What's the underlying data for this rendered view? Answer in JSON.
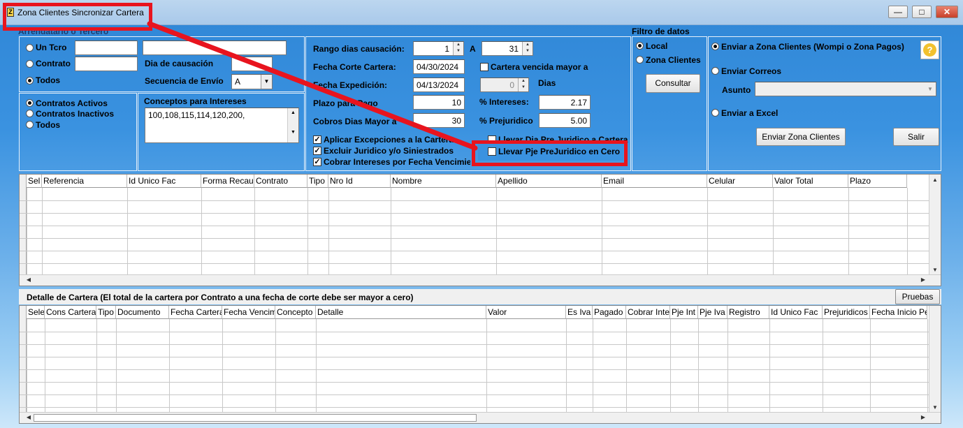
{
  "window": {
    "title": "Zona Clientes Sincronizar Cartera"
  },
  "left": {
    "group_label": "Arrendatario o Tercero",
    "un_tcro": "Un Tcro",
    "contrato": "Contrato",
    "todos": "Todos",
    "dia_causacion": "Dia de causación",
    "secuencia_envio": "Secuencia de Envío",
    "secuencia_value": "A",
    "contratos_activos": "Contratos Activos",
    "contratos_inactivos": "Contratos Inactivos",
    "todos2": "Todos",
    "conceptos_label": "Conceptos para Intereses",
    "conceptos_value": "100,108,115,114,120,200,"
  },
  "middle": {
    "rango_label": "Rango dias causación:",
    "rango_from": "1",
    "rango_a": "A",
    "rango_to": "31",
    "fecha_corte_label": "Fecha Corte Cartera:",
    "fecha_corte_value": "04/30/2024",
    "cartera_vencida_label": "Cartera vencida mayor a",
    "fecha_exp_label": "Fecha Expedición:",
    "fecha_exp_value": "04/13/2024",
    "dias_value": "0",
    "dias_label": "Dias",
    "plazo_label": "Plazo para Pago",
    "plazo_value": "10",
    "intereses_label": "% Intereses:",
    "intereses_value": "2.17",
    "cobros_label": "Cobros Dias Mayor a",
    "cobros_value": "30",
    "prejuridico_label": "% Prejuridico",
    "prejuridico_value": "5.00",
    "aplicar_label": "Aplicar Excepciones a la Cartera",
    "excluir_label": "Excluir Juridico y/o Siniestrados",
    "cobrar_label": "Cobrar Intereses por Fecha Vencimie",
    "llevar_dia_label": "Llevar Dia Pre Juridico a Cartera",
    "llevar_pje_label": "Llevar Pje PreJuridico en Cero"
  },
  "filtro": {
    "title": "Filtro de datos",
    "local": "Local",
    "zona": "Zona Clientes",
    "consultar": "Consultar"
  },
  "right": {
    "enviar_zona": "Enviar a Zona Clientes (Wompi o Zona Pagos)",
    "enviar_correos": "Enviar Correos",
    "asunto": "Asunto",
    "enviar_excel": "Enviar a Excel",
    "btn_enviar": "Enviar Zona Clientes",
    "btn_salir": "Salir",
    "help_glyph": "?"
  },
  "grid1": {
    "columns": [
      "Sel",
      "Referencia",
      "Id Unico Fac",
      "Forma Recau",
      "Contrato",
      "Tipo",
      "Nro Id",
      "Nombre",
      "Apellido",
      "Email",
      "Celular",
      "Valor Total",
      "Plazo"
    ]
  },
  "detalle": {
    "title": "Detalle de Cartera (El total de la cartera por Contrato a una fecha de corte debe ser mayor a cero)",
    "pruebas": "Pruebas"
  },
  "grid2": {
    "columns": [
      "Sele",
      "Cons Cartera",
      "Tipo",
      "Documento",
      "Fecha Cartera",
      "Fecha Vencim",
      "Concepto",
      "Detalle",
      "Valor",
      "Es Iva",
      "Pagado",
      "Cobrar Inte",
      "Pje Int",
      "Pje Iva",
      "Registro",
      "Id Unico Fac",
      "Prejuridicos",
      "Fecha Inicio Pe"
    ]
  },
  "colors": {
    "accent_red": "#e8141e",
    "sky": "#3a92e0"
  }
}
